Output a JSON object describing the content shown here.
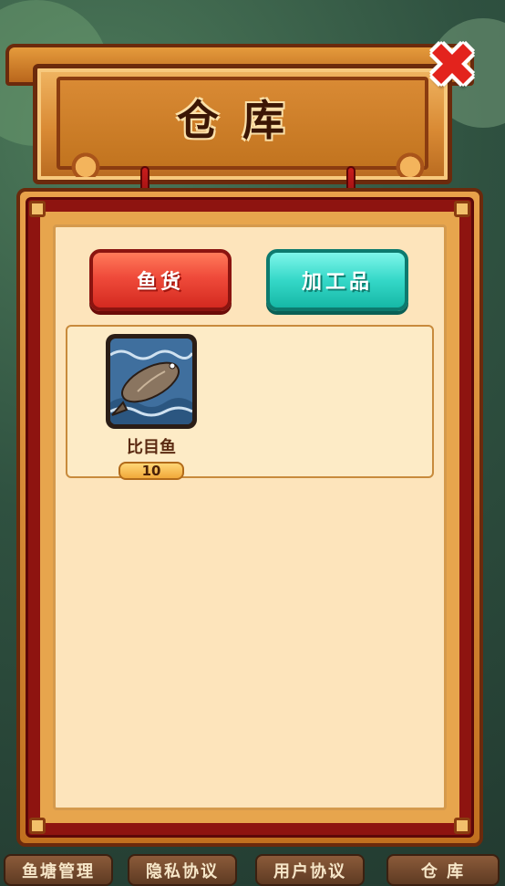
{
  "window": {
    "title": "仓库"
  },
  "close": {
    "icon": "close-icon",
    "color": "#e3231d"
  },
  "tabs": [
    {
      "label": "鱼货",
      "active": true,
      "color": "#ef4a3a"
    },
    {
      "label": "加工品",
      "active": false,
      "color": "#35d8c8"
    }
  ],
  "items": [
    {
      "name": "比目鱼",
      "count": "10",
      "icon": "flounder-fish-icon"
    }
  ],
  "bottom_nav": [
    {
      "label": "鱼塘管理"
    },
    {
      "label": "隐私协议"
    },
    {
      "label": "用户协议"
    },
    {
      "label": "仓 库"
    }
  ]
}
